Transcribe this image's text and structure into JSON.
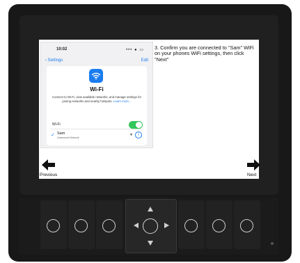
{
  "phone": {
    "time": "10:02",
    "status_icons": "••• ● ▭",
    "back_label": "Settings",
    "edit_label": "Edit",
    "wifi_title": "Wi-Fi",
    "description": "Connect to Wi-Fi, view available networks, and manage settings for joining networks and nearby hotspots.",
    "learn_more": "Learn more...",
    "wifi_row_label": "Wi-Fi",
    "wifi_enabled": true,
    "network_name": "Sam",
    "network_sub": "Unsecured Network",
    "check_glyph": "✓",
    "lock_glyph": "▼",
    "info_glyph": "i"
  },
  "instruction": "3. Confirm you are connected to \"Sam\" WiFi on your phones WiFi settings, then click \"Next\"",
  "nav": {
    "previous_label": "Previous",
    "next_label": "Next"
  },
  "icons": {
    "back": "chevron-left-icon",
    "wifi": "wifi-icon",
    "prev": "arrow-left-icon",
    "next": "arrow-right-icon"
  },
  "colors": {
    "accent": "#1a7cf0",
    "toggle_on": "#34c759",
    "device_body": "#181818"
  }
}
